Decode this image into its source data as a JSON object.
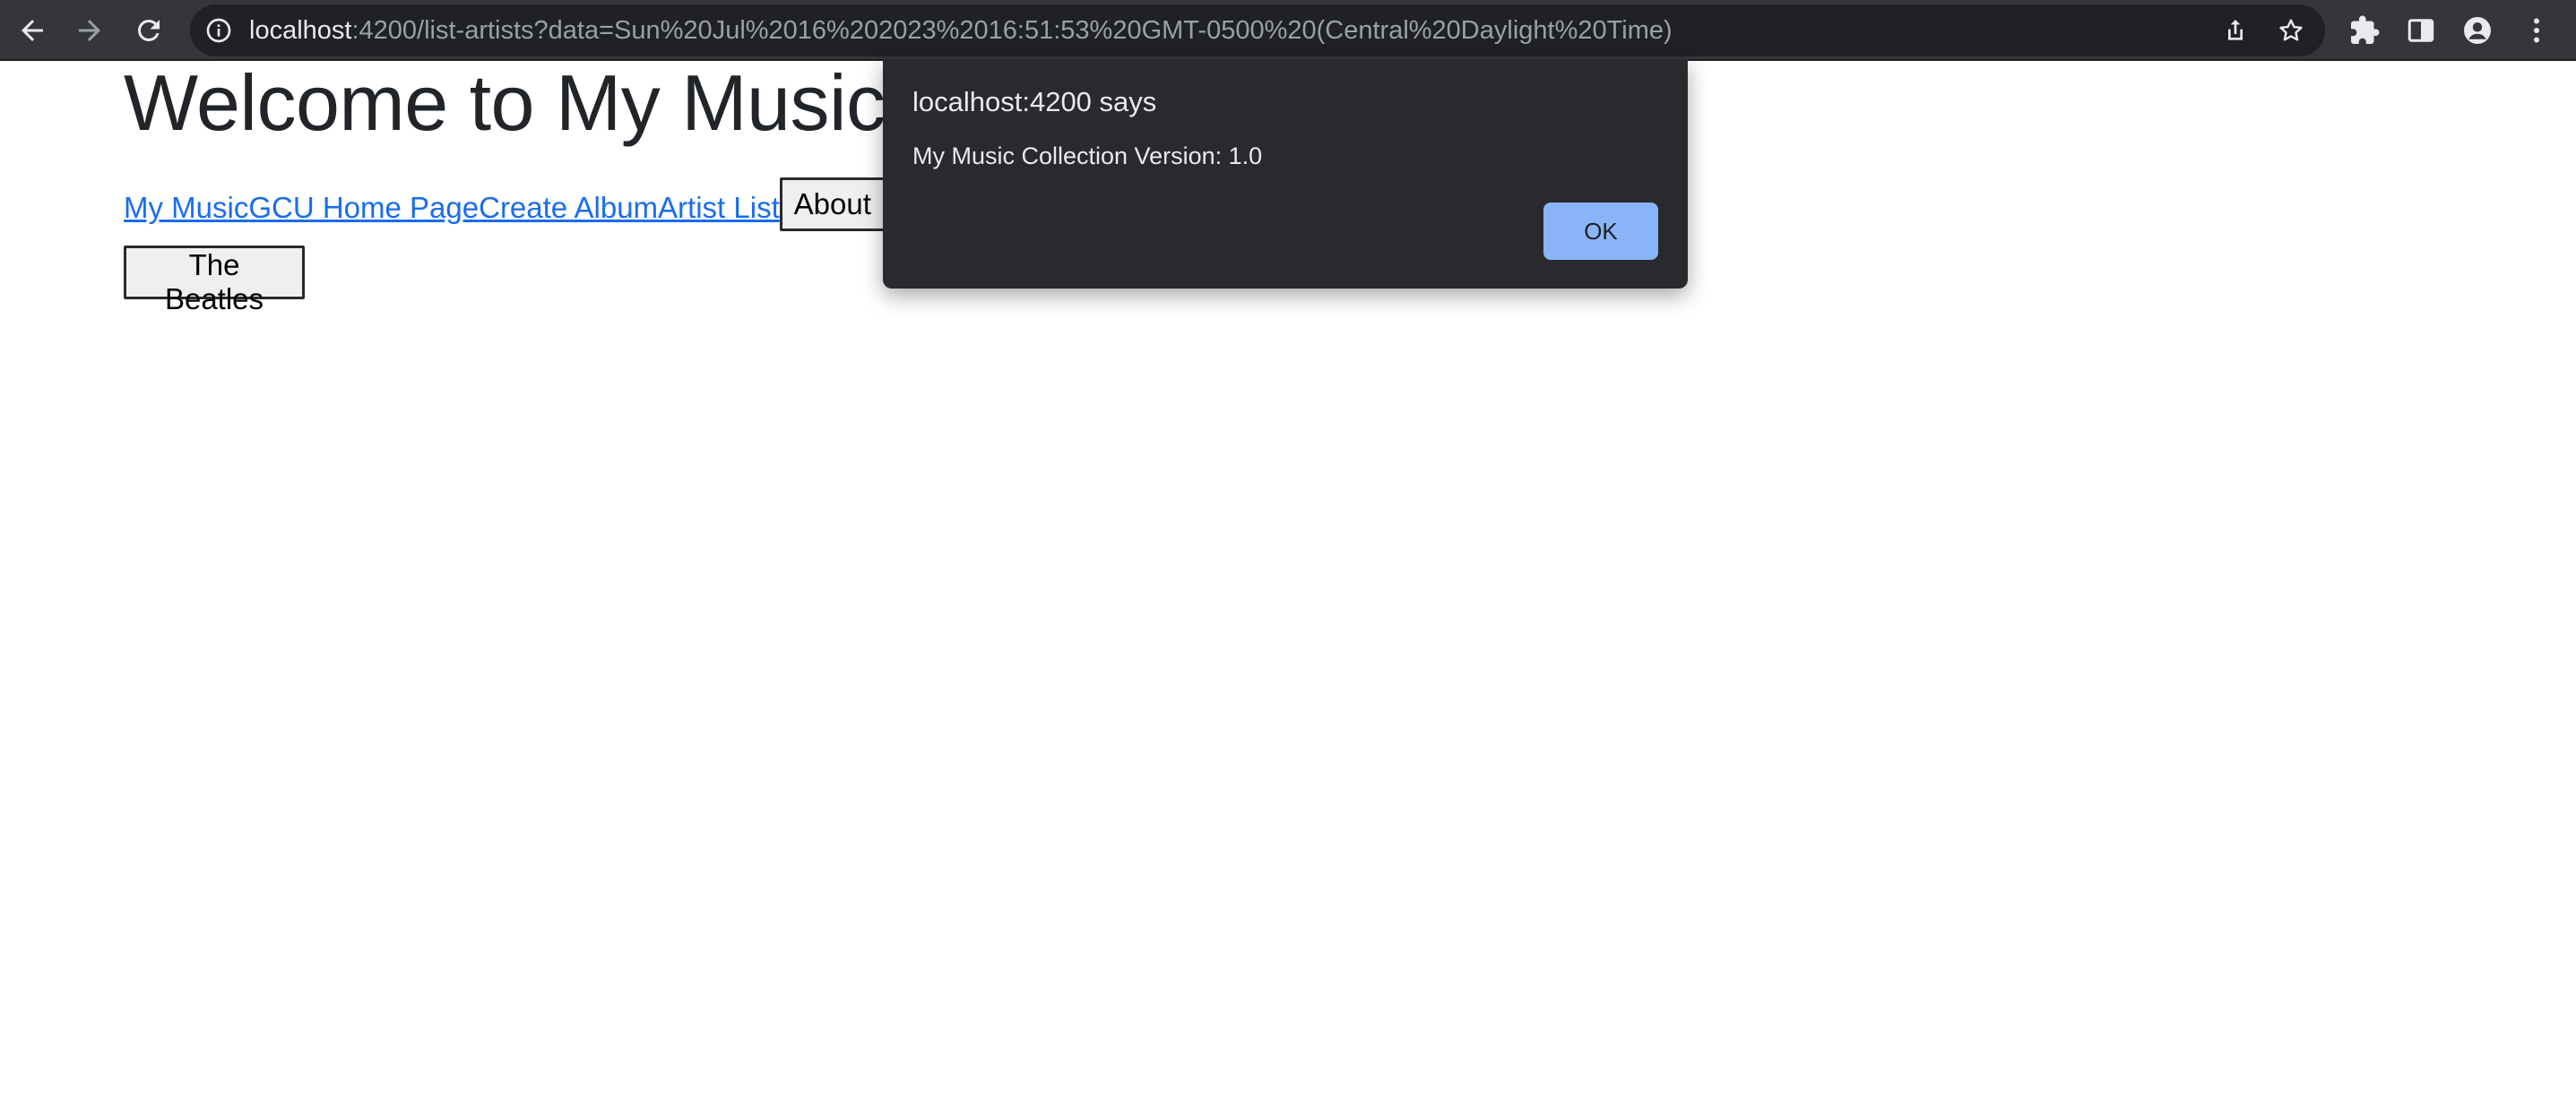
{
  "browser": {
    "url_host": "localhost",
    "url_rest": ":4200/list-artists?data=Sun%20Jul%2016%202023%2016:51:53%20GMT-0500%20(Central%20Daylight%20Time)",
    "icons": [
      "back-arrow-icon",
      "forward-arrow-icon",
      "reload-icon",
      "info-icon",
      "share-icon",
      "star-icon",
      "extensions-icon",
      "side-panel-icon",
      "profile-icon",
      "more-menu-icon"
    ]
  },
  "page": {
    "title": "Welcome to My Music Collection",
    "nav": {
      "my_music": "My Music",
      "gcu_home": "GCU Home Page",
      "create_album": "Create Album",
      "artist_list": "Artist List",
      "about": "About"
    },
    "artists": [
      "The Beatles"
    ]
  },
  "dialog": {
    "title": "localhost:4200 says",
    "message": "My Music Collection Version: 1.0",
    "ok_label": "OK"
  },
  "colors": {
    "toolbar": "#35363a",
    "omnibox": "#202124",
    "link": "#1a6ced",
    "dialog_bg": "#292a2d",
    "ok_button": "#8ab4f8"
  }
}
